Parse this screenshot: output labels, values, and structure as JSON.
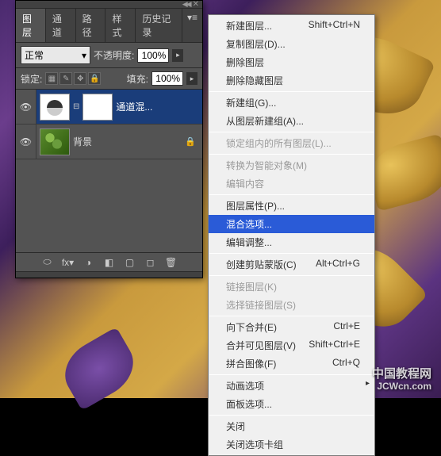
{
  "panel": {
    "tabs": [
      "图层",
      "通道",
      "路径",
      "样式",
      "历史记录"
    ],
    "blend_mode": "正常",
    "opacity_label": "不透明度:",
    "opacity_value": "100%",
    "lock_label": "锁定:",
    "fill_label": "填充:",
    "fill_value": "100%",
    "layers": [
      {
        "name": "通道混...",
        "selected": true,
        "locked": false,
        "adjustment": true
      },
      {
        "name": "背景",
        "selected": false,
        "locked": true,
        "adjustment": false
      }
    ],
    "bottom_icons": [
      "⬭",
      "fx▾",
      "◑",
      "◧",
      "▢",
      "◻",
      "🗑"
    ]
  },
  "menu": {
    "items": [
      {
        "label": "新建图层...",
        "shortcut": "Shift+Ctrl+N",
        "enabled": true
      },
      {
        "label": "复制图层(D)...",
        "enabled": true
      },
      {
        "label": "删除图层",
        "enabled": true
      },
      {
        "label": "删除隐藏图层",
        "enabled": true
      },
      {
        "sep": true
      },
      {
        "label": "新建组(G)...",
        "enabled": true
      },
      {
        "label": "从图层新建组(A)...",
        "enabled": true
      },
      {
        "sep": true
      },
      {
        "label": "锁定组内的所有图层(L)...",
        "enabled": false
      },
      {
        "sep": true
      },
      {
        "label": "转换为智能对象(M)",
        "enabled": false
      },
      {
        "label": "编辑内容",
        "enabled": false
      },
      {
        "sep": true
      },
      {
        "label": "图层属性(P)...",
        "enabled": true
      },
      {
        "label": "混合选项...",
        "enabled": true,
        "highlight": true
      },
      {
        "label": "编辑调整...",
        "enabled": true
      },
      {
        "sep": true
      },
      {
        "label": "创建剪贴蒙版(C)",
        "shortcut": "Alt+Ctrl+G",
        "enabled": true
      },
      {
        "sep": true
      },
      {
        "label": "链接图层(K)",
        "enabled": false
      },
      {
        "label": "选择链接图层(S)",
        "enabled": false
      },
      {
        "sep": true
      },
      {
        "label": "向下合并(E)",
        "shortcut": "Ctrl+E",
        "enabled": true
      },
      {
        "label": "合并可见图层(V)",
        "shortcut": "Shift+Ctrl+E",
        "enabled": true
      },
      {
        "label": "拼合图像(F)",
        "shortcut": "Ctrl+Q",
        "enabled": true
      },
      {
        "sep": true
      },
      {
        "label": "动画选项",
        "enabled": true,
        "submenu": true
      },
      {
        "label": "面板选项...",
        "enabled": true
      },
      {
        "sep": true
      },
      {
        "label": "关闭",
        "enabled": true
      },
      {
        "label": "关闭选项卡组",
        "enabled": true
      }
    ]
  },
  "watermark": {
    "cn": "中国教程网",
    "en": "JCWcn.com"
  }
}
